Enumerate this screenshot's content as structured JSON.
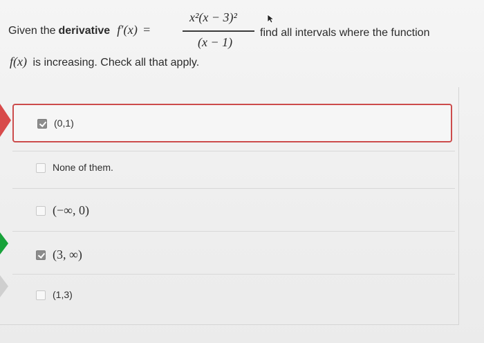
{
  "question": {
    "line1_prefix": "Given the ",
    "line1_bold": "derivative",
    "derivative_symbol": "f′(x)",
    "equals": "=",
    "numerator": "x²(x − 3)²",
    "denominator": "(x − 1)",
    "line1_suffix": "find all intervals where the function",
    "line2_function": "f(x)",
    "line2_text": "is increasing. Check all that apply."
  },
  "options": [
    {
      "label": "(0,1)",
      "checked": true,
      "selected": true
    },
    {
      "label": "None of them.",
      "checked": false,
      "selected": false
    },
    {
      "label": "(−∞, 0)",
      "checked": false,
      "selected": false
    },
    {
      "label": "(3, ∞)",
      "checked": true,
      "selected": false
    },
    {
      "label": "(1,3)",
      "checked": false,
      "selected": false
    }
  ],
  "colors": {
    "selected_border": "#cc4b4b",
    "marker_red": "#d84a4a",
    "marker_green": "#18a23a",
    "marker_grey": "#cfcfcf",
    "checkbox_checked": "#8c8c8c"
  },
  "icons": {
    "cursor": "pointer-cursor-icon",
    "checkbox_checked": "checkbox-checked-icon",
    "checkbox_unchecked": "checkbox-unchecked-icon"
  }
}
